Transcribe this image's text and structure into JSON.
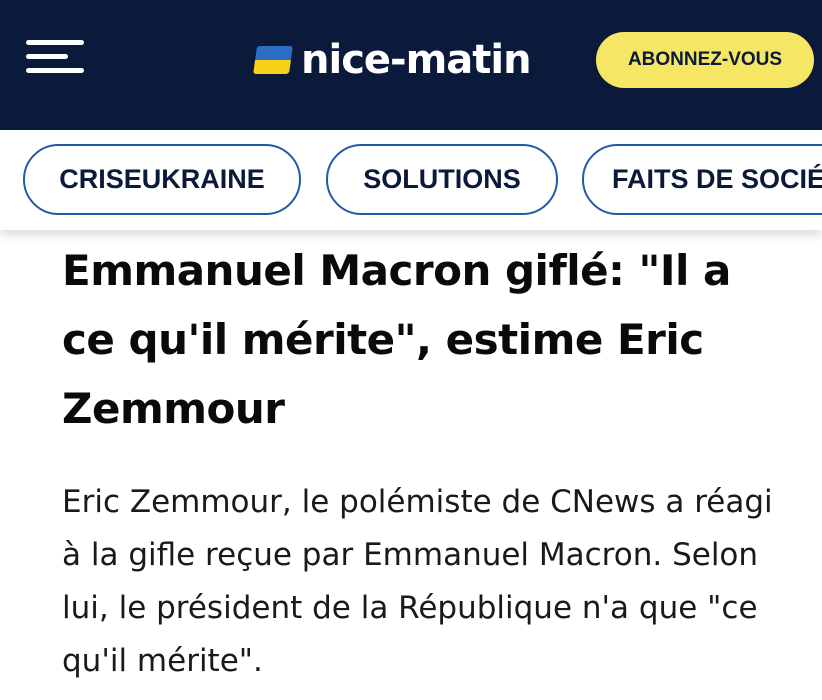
{
  "header": {
    "logo_text": "nice-matin",
    "subscribe_label": "ABONNEZ-VOUS",
    "menu_icon": "hamburger-menu-icon",
    "flag_icon": "ukraine-flag-icon",
    "colors": {
      "background": "#0b1a3a",
      "subscribe_bg": "#f5e663",
      "flag_top": "#2b6cc4",
      "flag_bottom": "#f7d117"
    }
  },
  "tags": [
    {
      "label": "CRISEUKRAINE"
    },
    {
      "label": "SOLUTIONS"
    },
    {
      "label": "FAITS DE SOCIÉTÉ"
    }
  ],
  "article": {
    "headline": "Emmanuel Macron giflé: \"Il a ce qu'il mérite\", estime Eric Zemmour",
    "lead": "Eric Zemmour, le polémiste de CNews a réagi à la gifle reçue par Emmanuel Macron. Selon lui, le président de la République n'a que \"ce qu'il mérite\"."
  }
}
